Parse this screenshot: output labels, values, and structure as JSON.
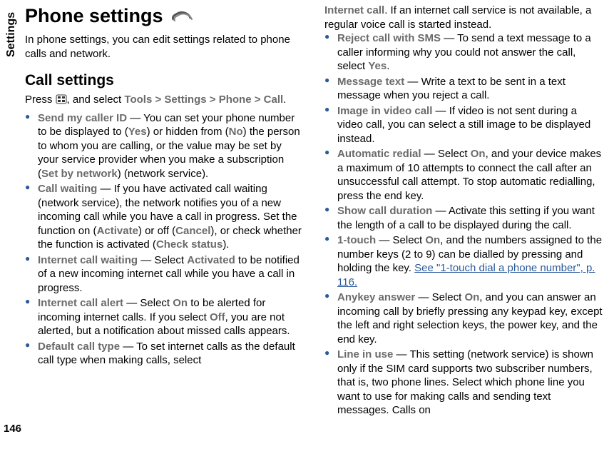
{
  "sidebar": {
    "section_label": "Settings",
    "page_number": "146"
  },
  "left": {
    "title": "Phone settings",
    "intro": "In phone settings, you can edit settings related to phone calls and network.",
    "subtitle": "Call settings",
    "press_prefix": "Press ",
    "press_mid1": ", and select ",
    "tools": "Tools",
    "gt": ">",
    "settings": "Settings",
    "phone": "Phone",
    "call": "Call",
    "period": ".",
    "items": [
      {
        "label": "Send my caller ID",
        "dash": "  — ",
        "t1": "You can set your phone number to be displayed to (",
        "v1": "Yes",
        "t2": ") or hidden from (",
        "v2": "No",
        "t3": ") the person to whom you are calling, or the value may be set by your service provider when you make a subscription (",
        "v3": "Set by network",
        "t4": ") (network service)."
      },
      {
        "label": "Call waiting",
        "dash": "  — ",
        "t1": "If you have activated call waiting (network service), the network notifies you of a new incoming call while you have a call in progress. Set the function on (",
        "v1": "Activate",
        "t2": ") or off (",
        "v2": "Cancel",
        "t3": "), or check whether the function is activated (",
        "v3": "Check status",
        "t4": ")."
      },
      {
        "label": "Internet call waiting",
        "dash": "  — ",
        "t1": "Select ",
        "v1": "Activated",
        "t2": " to be notified of a new incoming internet call while you have a call in progress."
      },
      {
        "label": "Internet call alert",
        "dash": "  — ",
        "t1": "Select ",
        "v1": "On",
        "t2": " to be alerted for incoming internet calls. If you select ",
        "v2": "Off",
        "t3": ", you are not alerted, but a notification about missed calls appears."
      },
      {
        "label": "Default call type",
        "dash": "  — ",
        "t1": "To set internet calls as the default call type when making calls, select "
      }
    ]
  },
  "right": {
    "cont_label": "Internet call",
    "cont_text": ". If an internet call service is not available, a regular voice call is started instead.",
    "items": [
      {
        "label": "Reject call with SMS",
        "dash": "  — ",
        "t1": "To send a text message to a caller informing why you could not answer the call, select ",
        "v1": "Yes",
        "t2": "."
      },
      {
        "label": "Message text",
        "dash": "  — ",
        "t1": "Write a text to be sent in a text message when you reject a call."
      },
      {
        "label": "Image in video call",
        "dash": "  — ",
        "t1": "If video is not sent during a video call, you can select a still image to be displayed instead."
      },
      {
        "label": "Automatic redial",
        "dash": "  — ",
        "t1": "Select ",
        "v1": "On",
        "t2": ", and your device makes a maximum of 10 attempts to connect the call after an unsuccessful call attempt. To stop automatic redialling, press the end key."
      },
      {
        "label": "Show call duration",
        "dash": "  — ",
        "t1": "Activate this setting if you want the length of a call to be displayed during the call."
      },
      {
        "label": "1-touch",
        "dash": "  — ",
        "t1": "Select ",
        "v1": "On",
        "t2": ", and the numbers assigned to the number keys (2 to 9) can be dialled by pressing and holding the key. ",
        "link": "See \"1-touch dial a phone number\", p. 116."
      },
      {
        "label": "Anykey answer",
        "dash": "  — ",
        "t1": "Select ",
        "v1": "On",
        "t2": ", and you can answer an incoming call by briefly pressing any keypad key, except the left and right selection keys, the power key, and the end key."
      },
      {
        "label": "Line in use",
        "dash": "  — ",
        "t1": "This setting (network service) is shown only if the SIM card supports two subscriber numbers, that is, two phone lines. Select which phone line you want to use for making calls and sending text messages. Calls on"
      }
    ]
  }
}
